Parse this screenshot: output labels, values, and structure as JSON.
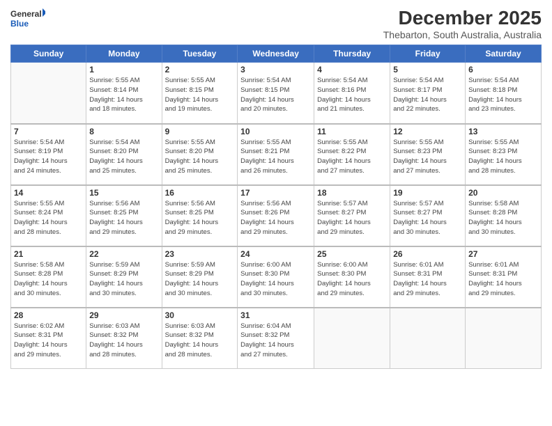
{
  "logo": {
    "line1": "General",
    "line2": "Blue"
  },
  "title": "December 2025",
  "subtitle": "Thebarton, South Australia, Australia",
  "weekdays": [
    "Sunday",
    "Monday",
    "Tuesday",
    "Wednesday",
    "Thursday",
    "Friday",
    "Saturday"
  ],
  "weeks": [
    [
      {
        "day": "",
        "info": ""
      },
      {
        "day": "1",
        "info": "Sunrise: 5:55 AM\nSunset: 8:14 PM\nDaylight: 14 hours\nand 18 minutes."
      },
      {
        "day": "2",
        "info": "Sunrise: 5:55 AM\nSunset: 8:15 PM\nDaylight: 14 hours\nand 19 minutes."
      },
      {
        "day": "3",
        "info": "Sunrise: 5:54 AM\nSunset: 8:15 PM\nDaylight: 14 hours\nand 20 minutes."
      },
      {
        "day": "4",
        "info": "Sunrise: 5:54 AM\nSunset: 8:16 PM\nDaylight: 14 hours\nand 21 minutes."
      },
      {
        "day": "5",
        "info": "Sunrise: 5:54 AM\nSunset: 8:17 PM\nDaylight: 14 hours\nand 22 minutes."
      },
      {
        "day": "6",
        "info": "Sunrise: 5:54 AM\nSunset: 8:18 PM\nDaylight: 14 hours\nand 23 minutes."
      }
    ],
    [
      {
        "day": "7",
        "info": "Sunrise: 5:54 AM\nSunset: 8:19 PM\nDaylight: 14 hours\nand 24 minutes."
      },
      {
        "day": "8",
        "info": "Sunrise: 5:54 AM\nSunset: 8:20 PM\nDaylight: 14 hours\nand 25 minutes."
      },
      {
        "day": "9",
        "info": "Sunrise: 5:55 AM\nSunset: 8:20 PM\nDaylight: 14 hours\nand 25 minutes."
      },
      {
        "day": "10",
        "info": "Sunrise: 5:55 AM\nSunset: 8:21 PM\nDaylight: 14 hours\nand 26 minutes."
      },
      {
        "day": "11",
        "info": "Sunrise: 5:55 AM\nSunset: 8:22 PM\nDaylight: 14 hours\nand 27 minutes."
      },
      {
        "day": "12",
        "info": "Sunrise: 5:55 AM\nSunset: 8:23 PM\nDaylight: 14 hours\nand 27 minutes."
      },
      {
        "day": "13",
        "info": "Sunrise: 5:55 AM\nSunset: 8:23 PM\nDaylight: 14 hours\nand 28 minutes."
      }
    ],
    [
      {
        "day": "14",
        "info": "Sunrise: 5:55 AM\nSunset: 8:24 PM\nDaylight: 14 hours\nand 28 minutes."
      },
      {
        "day": "15",
        "info": "Sunrise: 5:56 AM\nSunset: 8:25 PM\nDaylight: 14 hours\nand 29 minutes."
      },
      {
        "day": "16",
        "info": "Sunrise: 5:56 AM\nSunset: 8:25 PM\nDaylight: 14 hours\nand 29 minutes."
      },
      {
        "day": "17",
        "info": "Sunrise: 5:56 AM\nSunset: 8:26 PM\nDaylight: 14 hours\nand 29 minutes."
      },
      {
        "day": "18",
        "info": "Sunrise: 5:57 AM\nSunset: 8:27 PM\nDaylight: 14 hours\nand 29 minutes."
      },
      {
        "day": "19",
        "info": "Sunrise: 5:57 AM\nSunset: 8:27 PM\nDaylight: 14 hours\nand 30 minutes."
      },
      {
        "day": "20",
        "info": "Sunrise: 5:58 AM\nSunset: 8:28 PM\nDaylight: 14 hours\nand 30 minutes."
      }
    ],
    [
      {
        "day": "21",
        "info": "Sunrise: 5:58 AM\nSunset: 8:28 PM\nDaylight: 14 hours\nand 30 minutes."
      },
      {
        "day": "22",
        "info": "Sunrise: 5:59 AM\nSunset: 8:29 PM\nDaylight: 14 hours\nand 30 minutes."
      },
      {
        "day": "23",
        "info": "Sunrise: 5:59 AM\nSunset: 8:29 PM\nDaylight: 14 hours\nand 30 minutes."
      },
      {
        "day": "24",
        "info": "Sunrise: 6:00 AM\nSunset: 8:30 PM\nDaylight: 14 hours\nand 30 minutes."
      },
      {
        "day": "25",
        "info": "Sunrise: 6:00 AM\nSunset: 8:30 PM\nDaylight: 14 hours\nand 29 minutes."
      },
      {
        "day": "26",
        "info": "Sunrise: 6:01 AM\nSunset: 8:31 PM\nDaylight: 14 hours\nand 29 minutes."
      },
      {
        "day": "27",
        "info": "Sunrise: 6:01 AM\nSunset: 8:31 PM\nDaylight: 14 hours\nand 29 minutes."
      }
    ],
    [
      {
        "day": "28",
        "info": "Sunrise: 6:02 AM\nSunset: 8:31 PM\nDaylight: 14 hours\nand 29 minutes."
      },
      {
        "day": "29",
        "info": "Sunrise: 6:03 AM\nSunset: 8:32 PM\nDaylight: 14 hours\nand 28 minutes."
      },
      {
        "day": "30",
        "info": "Sunrise: 6:03 AM\nSunset: 8:32 PM\nDaylight: 14 hours\nand 28 minutes."
      },
      {
        "day": "31",
        "info": "Sunrise: 6:04 AM\nSunset: 8:32 PM\nDaylight: 14 hours\nand 27 minutes."
      },
      {
        "day": "",
        "info": ""
      },
      {
        "day": "",
        "info": ""
      },
      {
        "day": "",
        "info": ""
      }
    ]
  ]
}
